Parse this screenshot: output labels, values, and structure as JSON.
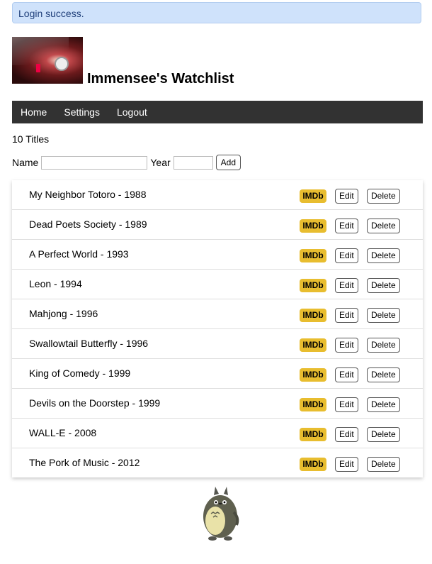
{
  "alert": {
    "text": "Login success."
  },
  "header": {
    "title": "Immensee's Watchlist",
    "logo_icon": "projector-photo"
  },
  "nav": {
    "items": [
      "Home",
      "Settings",
      "Logout"
    ]
  },
  "summary": {
    "count_text": "10 Titles"
  },
  "add_form": {
    "name_label": "Name",
    "name_value": "",
    "year_label": "Year",
    "year_value": "",
    "add_label": "Add"
  },
  "movies": [
    {
      "title": "My Neighbor Totoro - 1988",
      "imdb": "IMDb",
      "edit": "Edit",
      "delete": "Delete"
    },
    {
      "title": "Dead Poets Society - 1989",
      "imdb": "IMDb",
      "edit": "Edit",
      "delete": "Delete"
    },
    {
      "title": "A Perfect World - 1993",
      "imdb": "IMDb",
      "edit": "Edit",
      "delete": "Delete"
    },
    {
      "title": "Leon - 1994",
      "imdb": "IMDb",
      "edit": "Edit",
      "delete": "Delete"
    },
    {
      "title": "Mahjong - 1996",
      "imdb": "IMDb",
      "edit": "Edit",
      "delete": "Delete"
    },
    {
      "title": "Swallowtail Butterfly - 1996",
      "imdb": "IMDb",
      "edit": "Edit",
      "delete": "Delete"
    },
    {
      "title": "King of Comedy - 1999",
      "imdb": "IMDb",
      "edit": "Edit",
      "delete": "Delete"
    },
    {
      "title": "Devils on the Doorstep - 1999",
      "imdb": "IMDb",
      "edit": "Edit",
      "delete": "Delete"
    },
    {
      "title": "WALL-E - 2008",
      "imdb": "IMDb",
      "edit": "Edit",
      "delete": "Delete"
    },
    {
      "title": "The Pork of Music - 2012",
      "imdb": "IMDb",
      "edit": "Edit",
      "delete": "Delete"
    }
  ],
  "footer": {
    "image_icon": "totoro-icon"
  },
  "colors": {
    "alert_bg": "#cfe2fb",
    "nav_bg": "#323232",
    "imdb_badge": "#e8bd2f"
  }
}
